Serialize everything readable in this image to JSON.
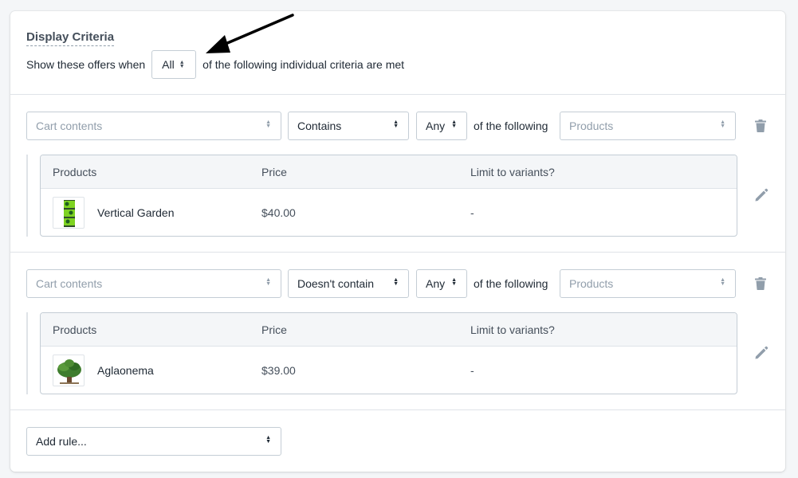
{
  "header": {
    "title": "Display Criteria",
    "show_prefix": "Show these offers when",
    "match_mode": "All",
    "show_suffix": "of the following individual criteria are met"
  },
  "rules": [
    {
      "subject_placeholder": "Cart contents",
      "condition": "Contains",
      "quantifier": "Any",
      "connector": "of the following",
      "target_placeholder": "Products",
      "table": {
        "columns": [
          "Products",
          "Price",
          "Limit to variants?"
        ],
        "rows": [
          {
            "name": "Vertical Garden",
            "price": "$40.00",
            "limit": "-",
            "thumbnail": "vertical-garden-image"
          }
        ]
      }
    },
    {
      "subject_placeholder": "Cart contents",
      "condition": "Doesn't contain",
      "quantifier": "Any",
      "connector": "of the following",
      "target_placeholder": "Products",
      "table": {
        "columns": [
          "Products",
          "Price",
          "Limit to variants?"
        ],
        "rows": [
          {
            "name": "Aglaonema",
            "price": "$39.00",
            "limit": "-",
            "thumbnail": "aglaonema-image"
          }
        ]
      }
    }
  ],
  "add_rule": {
    "placeholder": "Add rule..."
  },
  "icons": {
    "delete": "trash-icon",
    "edit": "pencil-icon",
    "select": "select-arrows-icon"
  },
  "colors": {
    "border": "#c4cdd5",
    "placeholder": "#919eab",
    "text": "#212b36",
    "table_header_bg": "#f4f6f8"
  }
}
